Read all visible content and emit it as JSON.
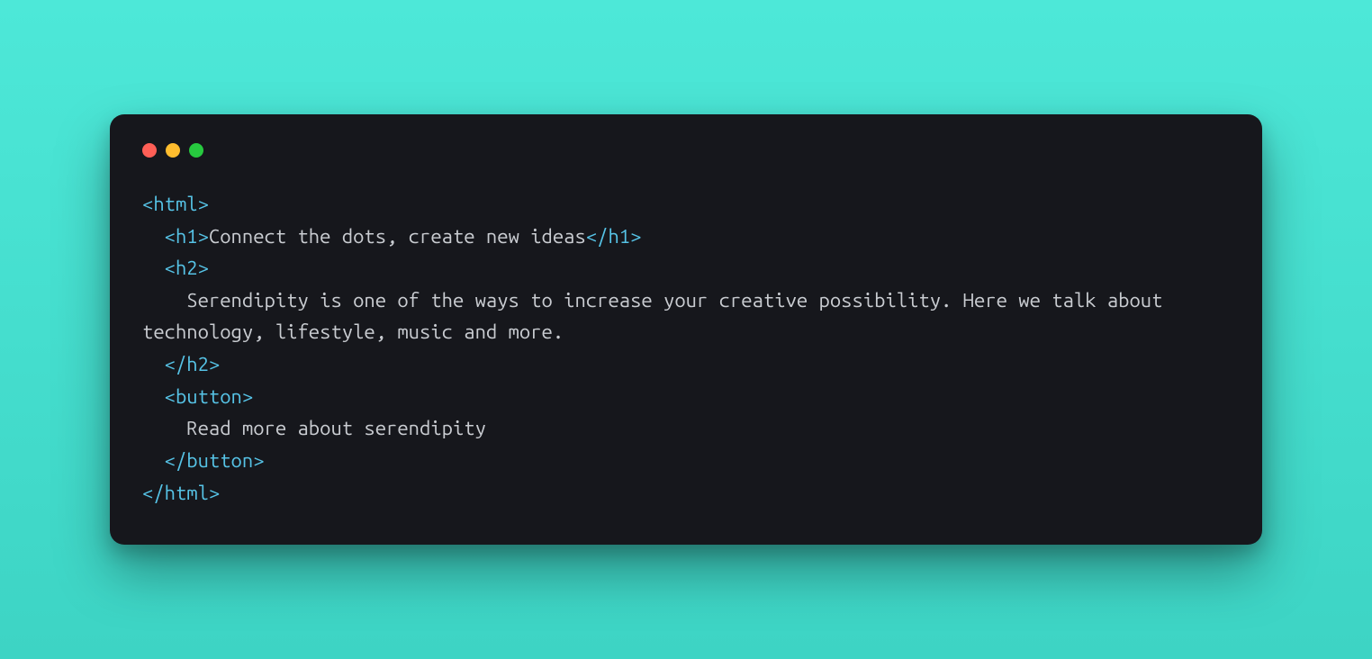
{
  "colors": {
    "background": "#40e0d0",
    "window_bg": "#16171c",
    "tag_color": "#56c3e6",
    "text_color": "#c9ccd1",
    "dot_red": "#ff5f56",
    "dot_yellow": "#ffbd2e",
    "dot_green": "#27c93f"
  },
  "code": {
    "line1_open": "<html>",
    "line2_open": "<h1>",
    "line2_text": "Connect the dots, create new ideas",
    "line2_close": "</h1>",
    "line3_open": "<h2>",
    "line4_text": "Serendipity is one of the ways to increase your creative possibility. Here we talk about technology, lifestyle, music and more.",
    "line5_close": "</h2>",
    "line6_open": "<button>",
    "line7_text": "Read more about serendipity",
    "line8_close": "</button>",
    "line9_close": "</html>"
  },
  "indent": {
    "i0": "",
    "i1": "  ",
    "i2": "    "
  }
}
